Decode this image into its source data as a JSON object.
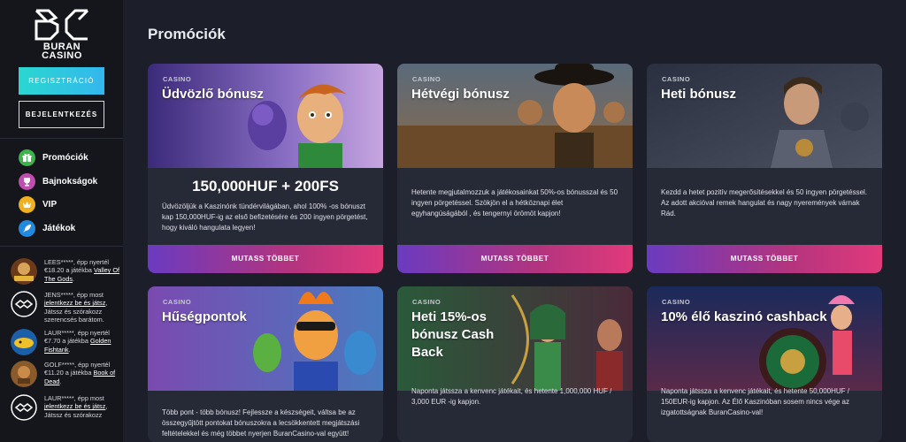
{
  "brand": {
    "line1": "BURAN",
    "line2": "CASINO"
  },
  "auth": {
    "register_label": "REGISZTRÁCIÓ",
    "login_label": "BEJELENTKEZÉS"
  },
  "nav": [
    {
      "label": "Promóciók",
      "icon": "gift-icon",
      "color": "#3bb54a"
    },
    {
      "label": "Bajnokságok",
      "icon": "trophy-icon",
      "color": "#c04db0"
    },
    {
      "label": "VIP",
      "icon": "vip-icon",
      "color": "#f0b11d"
    },
    {
      "label": "Játékok",
      "icon": "rocket-icon",
      "color": "#1f8ae0"
    }
  ],
  "feed": [
    {
      "user": "LEES*****",
      "text1": ", épp nyertél €18.20 a játékba ",
      "link": "Valley Of The Gods",
      "text2": "."
    },
    {
      "user": "JENS*****",
      "text1": ", épp most ",
      "link": "jelentkezz be és játsz",
      "text2": ", Játssz és szórakozz szerencsés barátom."
    },
    {
      "user": "LAUR*****",
      "text1": ", épp nyertél €7.70 a játékba ",
      "link": "Golden Fishtank",
      "text2": "."
    },
    {
      "user": "GOLF*****",
      "text1": ", épp nyertél €11.20 a játékba ",
      "link": "Book of Dead",
      "text2": "."
    },
    {
      "user": "LAUR*****",
      "text1": ", épp most ",
      "link": "jelentkezz be és játsz",
      "text2": ", Játssz és szórakozz"
    }
  ],
  "page_title": "Promóciók",
  "cards": [
    {
      "tag": "CASINO",
      "title": "Üdvözlő bónusz",
      "highlight": "150,000HUF + 200FS",
      "body": "Üdvözöljük a Kaszinónk tündérvilágában, ahol 100% -os bónuszt kap 150,000HUF-ig az első befizetésére és 200 ingyen pörgetést, hogy kiváló hangulata legyen!",
      "button": "MUTASS TÖBBET"
    },
    {
      "tag": "CASINO",
      "title": "Hétvégi bónusz",
      "body": "Hetente megjutalmozzuk a játékosainkat 50%-os bónusszal és 50 ingyen pörgetéssel. Szökjön el a hétköznapi élet egyhangúságából , és tengernyi örömöt kapjon!",
      "button": "MUTASS TÖBBET"
    },
    {
      "tag": "CASINO",
      "title": "Heti bónusz",
      "body": "Kezdd a hetet pozitív megerősítésekkel és 50 ingyen pörgetéssel. Az adott akcióval remek hangulat és nagy nyeremények várnak Rád.",
      "button": "MUTASS TÖBBET"
    },
    {
      "tag": "CASINO",
      "title": "Hűségpontok",
      "body": "Több pont - több bónusz! Fejlessze a készségeit, váltsa be az összegyűjtött pontokat bónuszokra a lecsökkentett megjátszási feltételekkel és még többet nyerjen BuranCasino-val együtt!"
    },
    {
      "tag": "CASINO",
      "title": "Heti 15%-os bónusz Cash Back",
      "body": "Naponta játssza a kenvenc játékait, és hetente 1,000,000 HUF / 3,000 EUR -ig kapjon."
    },
    {
      "tag": "CASINO",
      "title": "10% élő kaszinó cashback",
      "body": "Naponta játssza a kenvenc játékait, és hetente 50,000HUF / 150EUR-ig kapjon. Az Élő Kaszinóban sosem nincs vége az izgatottságnak BuranCasino-val!"
    }
  ]
}
